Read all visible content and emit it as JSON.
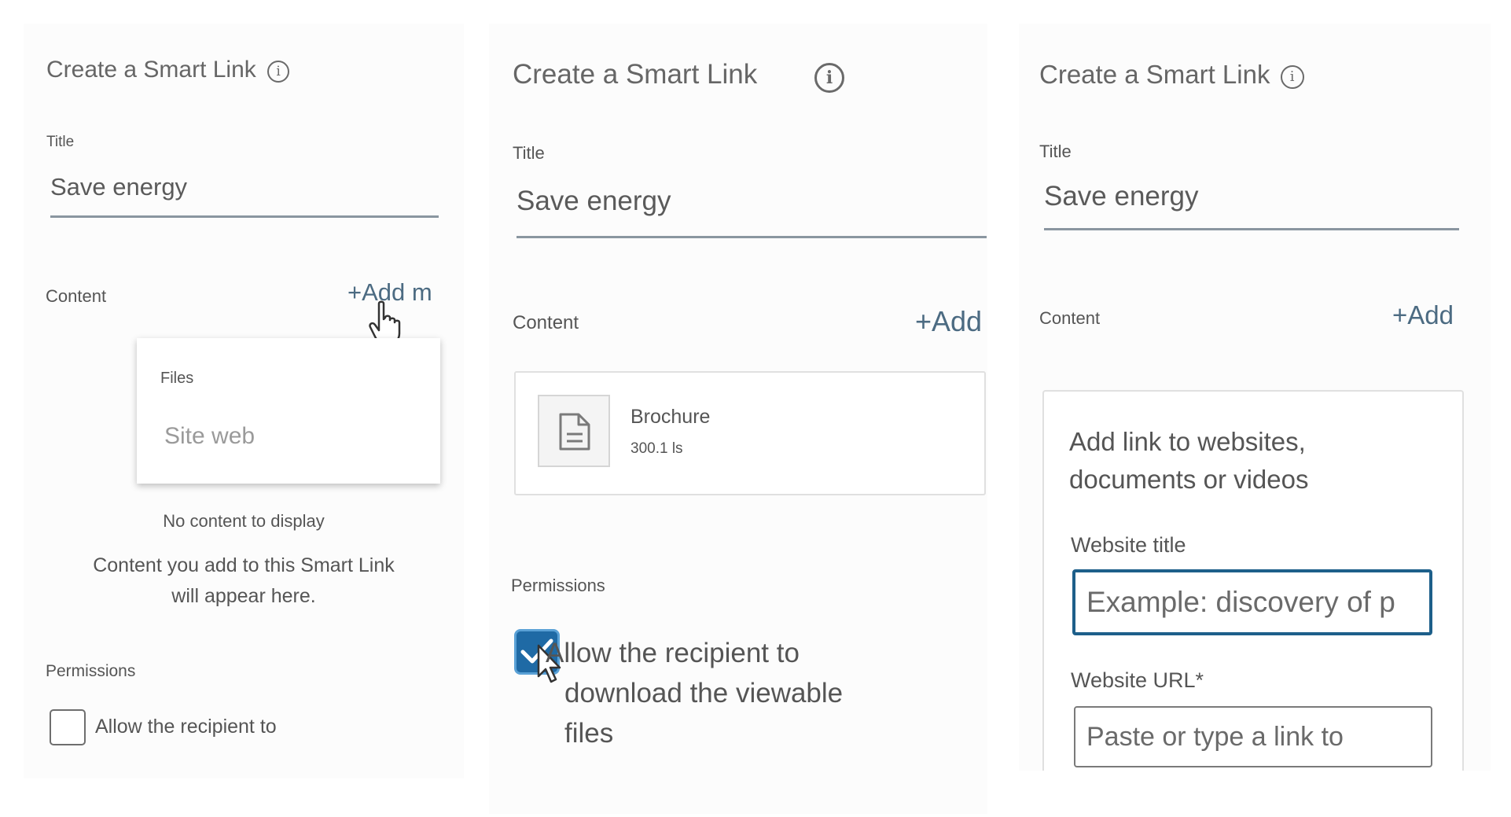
{
  "panel1": {
    "title": "Create a Smart Link",
    "info_icon_glyph": "i",
    "title_label": "Title",
    "title_value": "Save energy",
    "content_label": "Content",
    "add_link": "+Add m",
    "menu_items": [
      "Files",
      "Site web"
    ],
    "empty_heading": "No content to display",
    "empty_text_line1": "Content you add to this Smart Link",
    "empty_text_line2": "will appear here.",
    "permissions_label": "Permissions",
    "checkbox_label": "Allow the recipient to",
    "checkbox_checked": false
  },
  "panel2": {
    "title": "Create a Smart Link",
    "info_icon_glyph": "i",
    "title_label": "Title",
    "title_value": "Save energy",
    "content_label": "Content",
    "add_link": "+Add",
    "file": {
      "name": "Brochure",
      "size": "300.1 ls",
      "icon": "document-icon"
    },
    "permissions_label": "Permissions",
    "checkbox_label_line1": "Allow the recipient to",
    "checkbox_label_line2": "download the viewable",
    "checkbox_label_line3": "files",
    "checkbox_checked": true
  },
  "panel3": {
    "title": "Create a Smart Link",
    "info_icon_glyph": "i",
    "title_label": "Title",
    "title_value": "Save energy",
    "content_label": "Content",
    "add_link": "+Add",
    "card_heading_line1": "Add link to websites,",
    "card_heading_line2": "documents or videos",
    "website_title_label": "Website title",
    "website_title_placeholder": "Example: discovery of p",
    "website_url_label": "Website URL*",
    "website_url_placeholder": "Paste or type a link to"
  },
  "colors": {
    "accent": "#4c6b82",
    "focus_border": "#1d5f8a",
    "checkbox_checked_bg": "#1f6aa5",
    "text": "#5f6368"
  }
}
